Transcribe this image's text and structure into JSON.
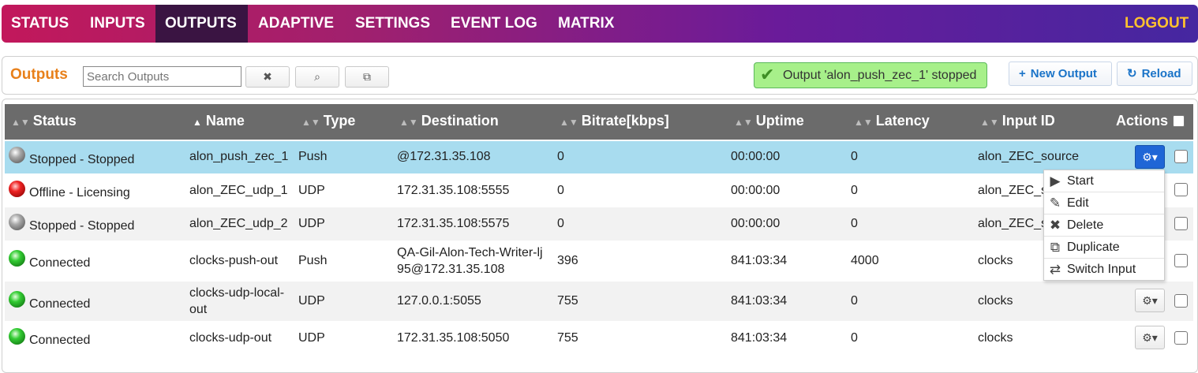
{
  "nav": {
    "items": [
      "STATUS",
      "INPUTS",
      "OUTPUTS",
      "ADAPTIVE",
      "SETTINGS",
      "EVENT LOG",
      "MATRIX"
    ],
    "active": "OUTPUTS",
    "logout": "LOGOUT"
  },
  "toolbar": {
    "title": "Outputs",
    "search_placeholder": "Search Outputs",
    "clear_icon": "✖",
    "search_icon": "⌕",
    "copy_icon": "⧉",
    "notice": "Output 'alon_push_zec_1' stopped",
    "new_output": "New Output",
    "new_output_icon": "+",
    "reload": "Reload",
    "reload_icon": "↻"
  },
  "table": {
    "columns": [
      "Status",
      "Name",
      "Type",
      "Destination",
      "Bitrate[kbps]",
      "Uptime",
      "Latency",
      "Input ID",
      "Actions"
    ],
    "sorted_column": "Name",
    "rows": [
      {
        "status": "Stopped - Stopped",
        "led": "gray",
        "name": "alon_push_zec_1",
        "type": "Push",
        "destination": "@172.31.35.108",
        "bitrate": "0",
        "uptime": "00:00:00",
        "latency": "0",
        "input_id": "alon_ZEC_source",
        "selected": true
      },
      {
        "status": "Offline - Licensing",
        "led": "red",
        "name": "alon_ZEC_udp_1",
        "type": "UDP",
        "destination": "172.31.35.108:5555",
        "bitrate": "0",
        "uptime": "00:00:00",
        "latency": "0",
        "input_id": "alon_ZEC_s"
      },
      {
        "status": "Stopped - Stopped",
        "led": "gray",
        "name": "alon_ZEC_udp_2",
        "type": "UDP",
        "destination": "172.31.35.108:5575",
        "bitrate": "0",
        "uptime": "00:00:00",
        "latency": "0",
        "input_id": "alon_ZEC_s"
      },
      {
        "status": "Connected",
        "led": "green",
        "name": "clocks-push-out",
        "type": "Push",
        "destination": "QA-Gil-Alon-Tech-Writer-lj95@172.31.35.108",
        "bitrate": "396",
        "uptime": "841:03:34",
        "latency": "4000",
        "input_id": "clocks"
      },
      {
        "status": "Connected",
        "led": "green",
        "name": "clocks-udp-local-out",
        "type": "UDP",
        "destination": "127.0.0.1:5055",
        "bitrate": "755",
        "uptime": "841:03:34",
        "latency": "0",
        "input_id": "clocks"
      },
      {
        "status": "Connected",
        "led": "green",
        "name": "clocks-udp-out",
        "type": "UDP",
        "destination": "172.31.35.108:5050",
        "bitrate": "755",
        "uptime": "841:03:34",
        "latency": "0",
        "input_id": "clocks"
      }
    ]
  },
  "actions_menu": {
    "items": [
      {
        "label": "Start",
        "icon": "▶"
      },
      {
        "label": "Edit",
        "icon": "✎"
      },
      {
        "label": "Delete",
        "icon": "✖"
      },
      {
        "label": "Duplicate",
        "icon": "⧉"
      },
      {
        "label": "Switch Input",
        "icon": "⇄"
      }
    ]
  },
  "colors": {
    "nav_gradient_start": "#c2185b",
    "nav_gradient_end": "#4527a0",
    "logout": "#ffc22e",
    "title_orange": "#e8801a",
    "selected_row": "#a8dcef",
    "notice_green": "#a7f08a",
    "header_gray": "#6b6b6b"
  }
}
